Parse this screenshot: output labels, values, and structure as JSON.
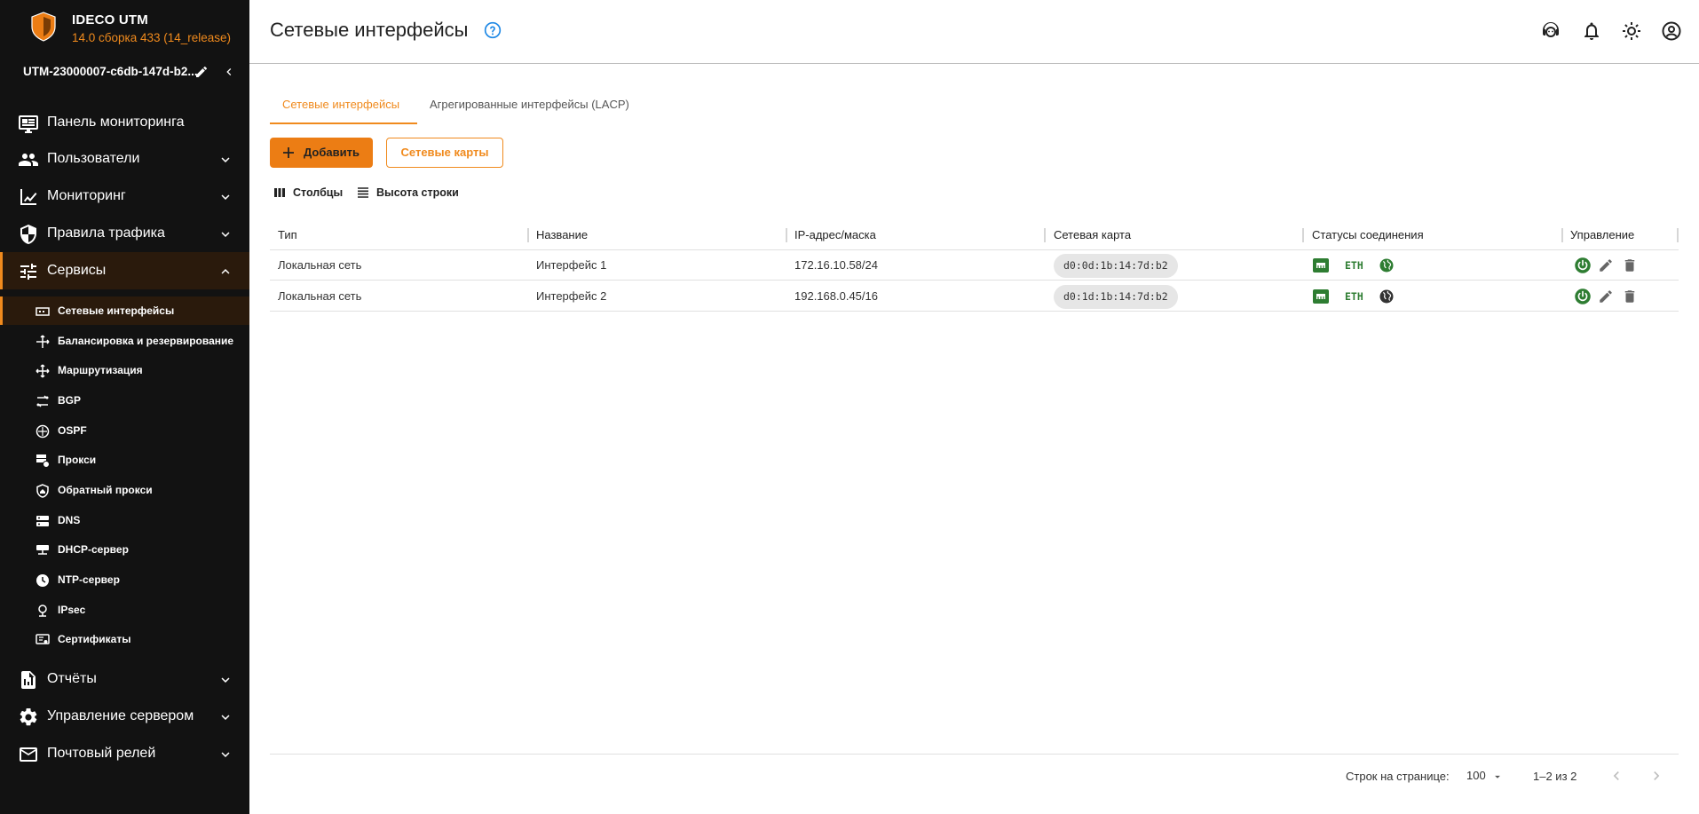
{
  "brand": {
    "name": "IDECO UTM",
    "version": "14.0 сборка 433 (14_release)"
  },
  "host": {
    "name": "UTM-23000007-c6db-147d-b2..."
  },
  "nav": {
    "items": [
      {
        "label": "Панель мониторинга"
      },
      {
        "label": "Пользователи"
      },
      {
        "label": "Мониторинг"
      },
      {
        "label": "Правила трафика"
      },
      {
        "label": "Сервисы"
      },
      {
        "label": "Отчёты"
      },
      {
        "label": "Управление сервером"
      },
      {
        "label": "Почтовый релей"
      }
    ],
    "sub": [
      {
        "label": "Сетевые интерфейсы"
      },
      {
        "label": "Балансировка и резервирование"
      },
      {
        "label": "Маршрутизация"
      },
      {
        "label": "BGP"
      },
      {
        "label": "OSPF"
      },
      {
        "label": "Прокси"
      },
      {
        "label": "Обратный прокси"
      },
      {
        "label": "DNS"
      },
      {
        "label": "DHCP-сервер"
      },
      {
        "label": "NTP-сервер"
      },
      {
        "label": "IPsec"
      },
      {
        "label": "Сертификаты"
      }
    ]
  },
  "header": {
    "title": "Сетевые интерфейсы"
  },
  "tabs": [
    {
      "label": "Сетевые интерфейсы"
    },
    {
      "label": "Агрегированные интерфейсы (LACP)"
    }
  ],
  "actions": {
    "add": "Добавить",
    "cards": "Сетевые карты"
  },
  "toolbar": {
    "columns": "Столбцы",
    "row_height": "Высота строки"
  },
  "table": {
    "headers": [
      "Тип",
      "Название",
      "IP-адрес/маска",
      "Сетевая карта",
      "Статусы соединения",
      "Управление"
    ],
    "rows": [
      {
        "type": "Локальная сеть",
        "name": "Интерфейс 1",
        "ip": "172.16.10.58/24",
        "nic": "d0:0d:1b:14:7d:b2",
        "link": "ETH"
      },
      {
        "type": "Локальная сеть",
        "name": "Интерфейс 2",
        "ip": "192.168.0.45/16",
        "nic": "d0:1d:1b:14:7d:b2",
        "link": "ETH"
      }
    ]
  },
  "pagination": {
    "rows_label": "Строк на странице:",
    "rows_value": "100",
    "range": "1–2 из 2"
  },
  "colors": {
    "accent": "#f08a1d",
    "sidebar": "#121212",
    "ok": "#2e7d32"
  }
}
